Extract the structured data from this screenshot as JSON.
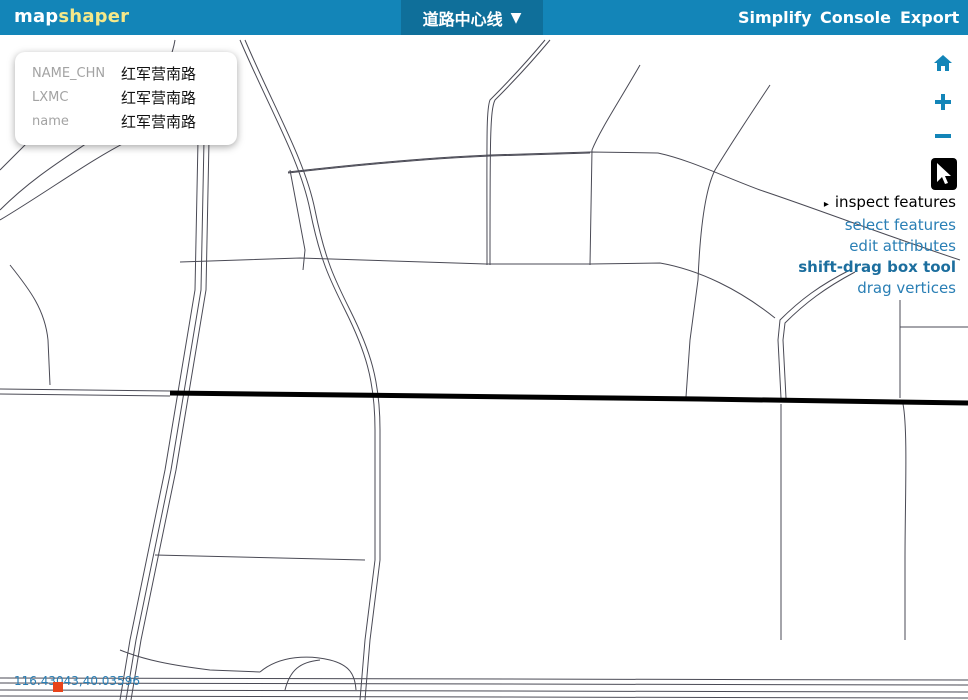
{
  "app": {
    "logo_part1": "map",
    "logo_part2": "shaper",
    "layer_name": "道路中心线",
    "layer_arrow": "▼",
    "buttons": {
      "simplify": "Simplify",
      "console": "Console",
      "export": "Export"
    }
  },
  "popup": {
    "rows": [
      {
        "key": "NAME_CHN",
        "value": "红军营南路"
      },
      {
        "key": "LXMC",
        "value": "红军营南路"
      },
      {
        "key": "name",
        "value": "红军营南路"
      }
    ]
  },
  "map_controls": {
    "home_icon": "home-icon",
    "zoom_in_icon": "plus-icon",
    "zoom_out_icon": "minus-icon",
    "pointer_icon": "pointer-icon"
  },
  "tool_menu": {
    "caret": "▸",
    "items": [
      "inspect features",
      "select features",
      "edit attributes",
      "shift-drag box tool",
      "drag vertices"
    ]
  },
  "status": {
    "coordinates": "116.43043,40.03596"
  },
  "colors": {
    "topbar": "#1385b8",
    "layer_menu": "#0f6f9a",
    "logo_accent": "#f5e889",
    "link": "#2a7fb5",
    "highlight_road": "#000000",
    "roads": "#4a4a55",
    "marker": "#e8431a"
  }
}
